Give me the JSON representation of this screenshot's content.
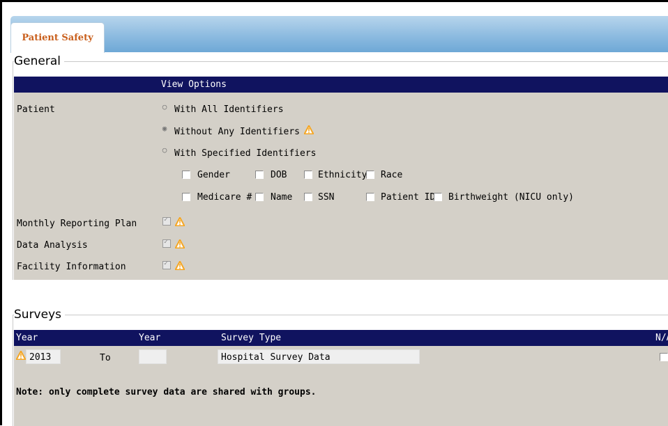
{
  "tabs": {
    "active_label": "Patient Safety"
  },
  "general": {
    "legend": "General",
    "header": "View Options",
    "patient_label": "Patient",
    "radios": [
      {
        "label": "With All Identifiers",
        "selected": false
      },
      {
        "label": "Without Any Identifiers",
        "selected": true
      },
      {
        "label": "With Specified Identifiers",
        "selected": false
      }
    ],
    "identifiers": [
      "Gender",
      "DOB",
      "Ethnicity",
      "Race",
      "Medicare #",
      "Name",
      "SSN",
      "Patient ID",
      "Birthweight (NICU only)"
    ],
    "options": [
      {
        "label": "Monthly Reporting Plan",
        "checked": true
      },
      {
        "label": "Data Analysis",
        "checked": true
      },
      {
        "label": "Facility Information",
        "checked": true
      }
    ]
  },
  "surveys": {
    "legend": "Surveys",
    "headers": {
      "year_from": "Year",
      "year_to": "Year",
      "survey_type": "Survey Type",
      "na": "N/A"
    },
    "row": {
      "year_from": "2013",
      "to_label": "To",
      "year_to": "",
      "survey_type": "Hospital Survey Data"
    },
    "note": "Note: only complete survey data are shared with groups."
  },
  "colors": {
    "header_bar": "#10135f",
    "panel_gray": "#d4d0c8",
    "tab_text": "#c95f1c",
    "warning": "#f5a623"
  }
}
